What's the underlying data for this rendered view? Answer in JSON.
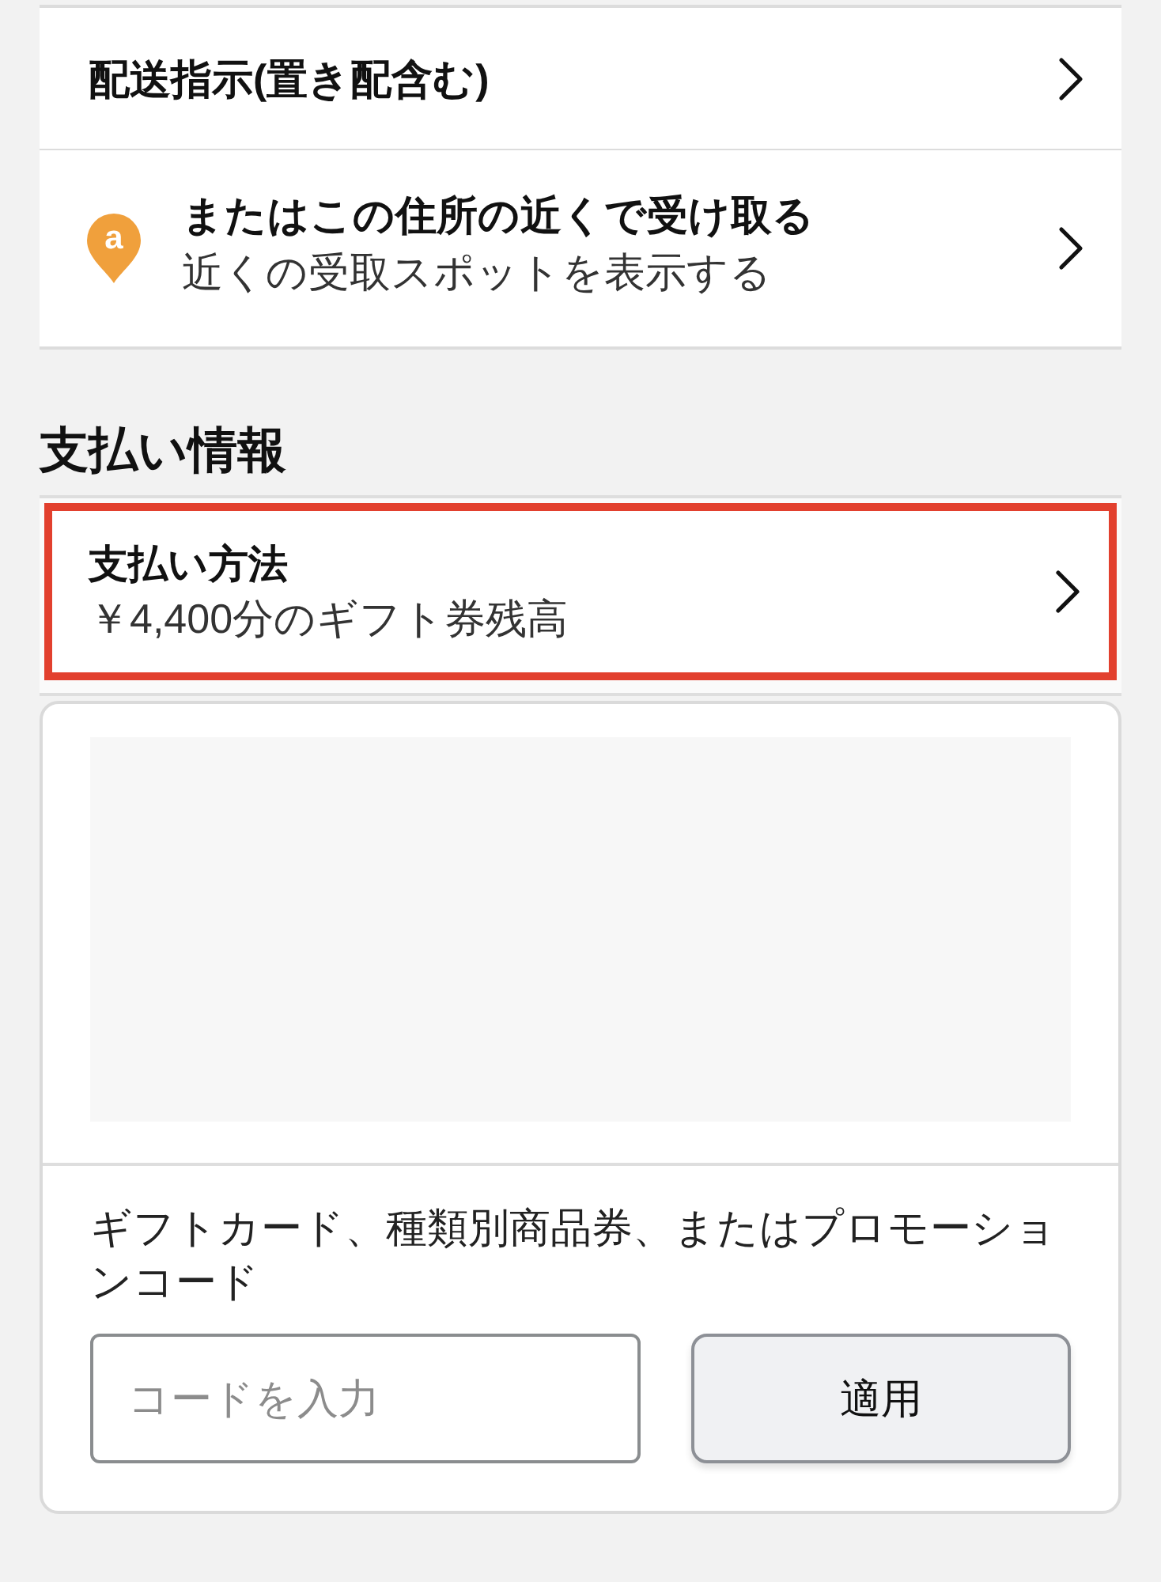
{
  "delivery_options": [
    {
      "kind": "link",
      "title": "配送指示(置き配含む)"
    },
    {
      "kind": "pickup",
      "pin_letter": "a",
      "title": "またはこの住所の近くで受け取る",
      "subtitle": "近くの受取スポットを表示する"
    }
  ],
  "payment_section": {
    "heading": "支払い情報",
    "method": {
      "title": "支払い方法",
      "subtitle": "￥4,400分のギフト券残高",
      "highlighted": true
    }
  },
  "promo": {
    "label": "ギフトカード、種類別商品券、またはプロモーションコード",
    "placeholder": "コードを入力",
    "apply_button": "適用"
  }
}
